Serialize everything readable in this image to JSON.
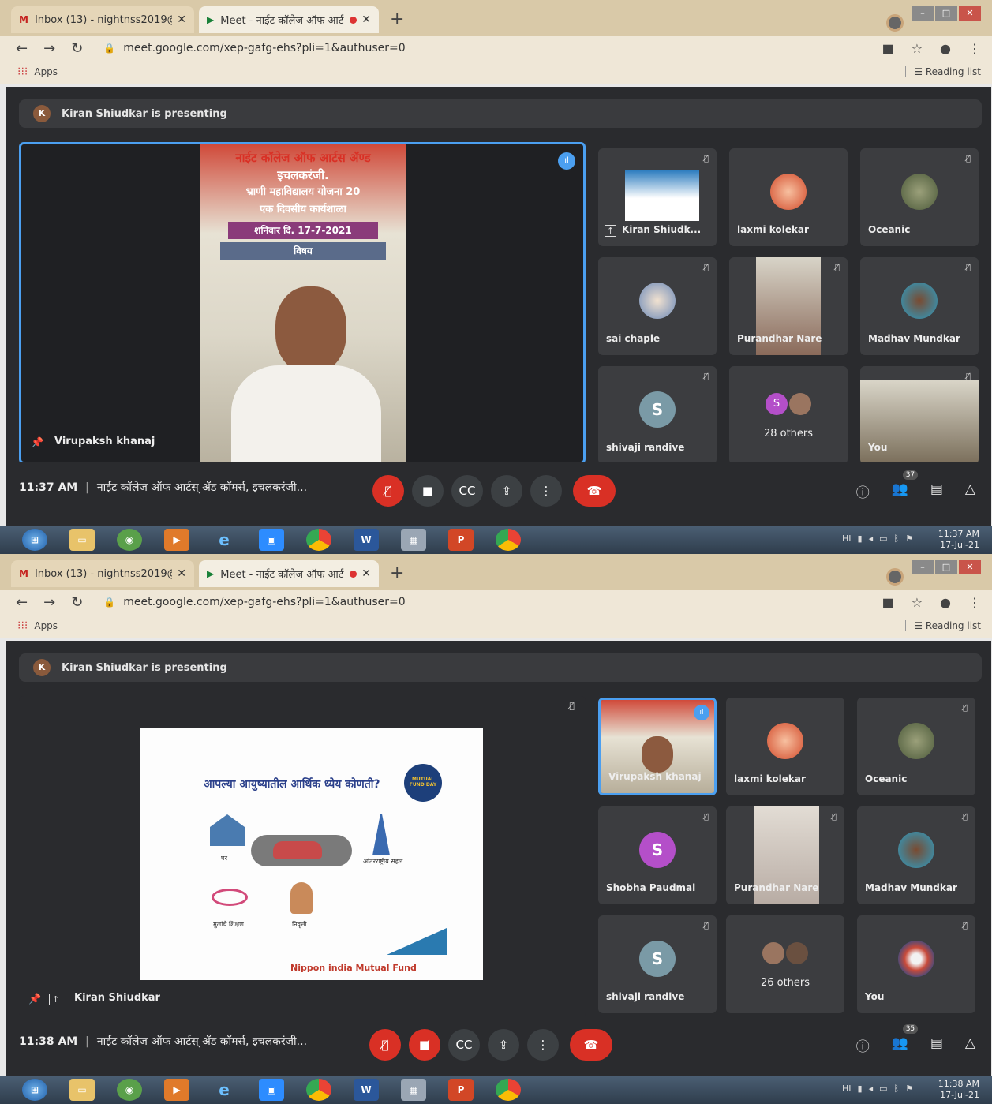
{
  "screens": [
    {
      "tabs": {
        "inactive": {
          "icon": "gmail-icon",
          "label": "Inbox (13) - nightnss2019@gmai"
        },
        "active": {
          "icon": "meet-icon",
          "label": "Meet - नाईट कॉलेज ऑफ आर्ट"
        }
      },
      "url": "meet.google.com/xep-gafg-ehs?pli=1&authuser=0",
      "bookmarks": {
        "apps": "Apps",
        "reading_list": "Reading list"
      },
      "presenting_banner": "Kiran Shiudkar is presenting",
      "stage": {
        "main_speaker": "Virupaksh khanaj",
        "poster_lines": [
          "नाईट कॉलेज ऑफ आर्टस ॲण्ड",
          "इचलकरंजी.",
          "भ्राणी महाविद्यालय योजना 20",
          "एक दिवसीय कार्यशाळा",
          "शनिवार दि. 17-7-2021",
          "विषय"
        ]
      },
      "tiles": [
        "Kiran Shiudk...",
        "laxmi kolekar",
        "Oceanic",
        "sai chaple",
        "Purandhar Nare",
        "Madhav Mundkar",
        "shivaji randive",
        "28 others",
        "You"
      ],
      "tile_initials": {
        "shivaji": "S",
        "others": "S"
      },
      "meeting_time": "11:37 AM",
      "meeting_sep": "|",
      "meeting_title": "नाईट कॉलेज ऑफ आर्टस् ॲड कॉमर्स, इचलकरंजी...",
      "participant_count": "37",
      "tray": {
        "time": "11:37 AM",
        "date": "17-Jul-21",
        "lang": "HI"
      }
    },
    {
      "tabs": {
        "inactive": {
          "icon": "gmail-icon",
          "label": "Inbox (13) - nightnss2019@gmai"
        },
        "active": {
          "icon": "meet-icon",
          "label": "Meet - नाईट कॉलेज ऑफ आर्ट"
        }
      },
      "url": "meet.google.com/xep-gafg-ehs?pli=1&authuser=0",
      "bookmarks": {
        "apps": "Apps",
        "reading_list": "Reading list"
      },
      "presenting_banner": "Kiran Shiudkar is presenting",
      "stage": {
        "main_speaker": "Kiran Shiudkar",
        "slide_title": "आपल्या आयुष्यातील आर्थिक ध्येय कोणती?",
        "slide_labels": [
          "घर",
          "आंतरराष्ट्रीय सहल",
          "मुलांचे शिक्षण",
          "निवृत्ती"
        ],
        "slide_brand": "Nippon india Mutual Fund",
        "slide_badge": "MUTUAL FUND DAY"
      },
      "tiles": [
        "Virupaksh khanaj",
        "laxmi kolekar",
        "Oceanic",
        "Shobha Paudmal",
        "Purandhar Nare",
        "Madhav Mundkar",
        "shivaji randive",
        "26 others",
        "You"
      ],
      "tile_initials": {
        "shobha": "S",
        "shivaji": "S"
      },
      "meeting_time": "11:38 AM",
      "meeting_sep": "|",
      "meeting_title": "नाईट कॉलेज ऑफ आर्टस् ॲड कॉमर्स, इचलकरंजी...",
      "participant_count": "35",
      "tray": {
        "time": "11:38 AM",
        "date": "17-Jul-21",
        "lang": "HI"
      }
    }
  ],
  "colors": {
    "meet_bg": "#2a2b2e",
    "tile_bg": "#3c3d40",
    "end_call": "#d93025",
    "active_speaker": "#4b9ff0",
    "tab_bar": "#d9c9a8"
  },
  "icons": [
    "gmail-icon",
    "meet-icon",
    "back-icon",
    "forward-icon",
    "reload-icon",
    "lock-icon",
    "apps-grid-icon",
    "reading-list-icon",
    "mic-off-icon",
    "camera-icon",
    "captions-icon",
    "present-icon",
    "more-icon",
    "end-call-icon",
    "info-icon",
    "people-icon",
    "chat-icon",
    "activities-icon",
    "pin-icon",
    "windows-start-icon"
  ]
}
